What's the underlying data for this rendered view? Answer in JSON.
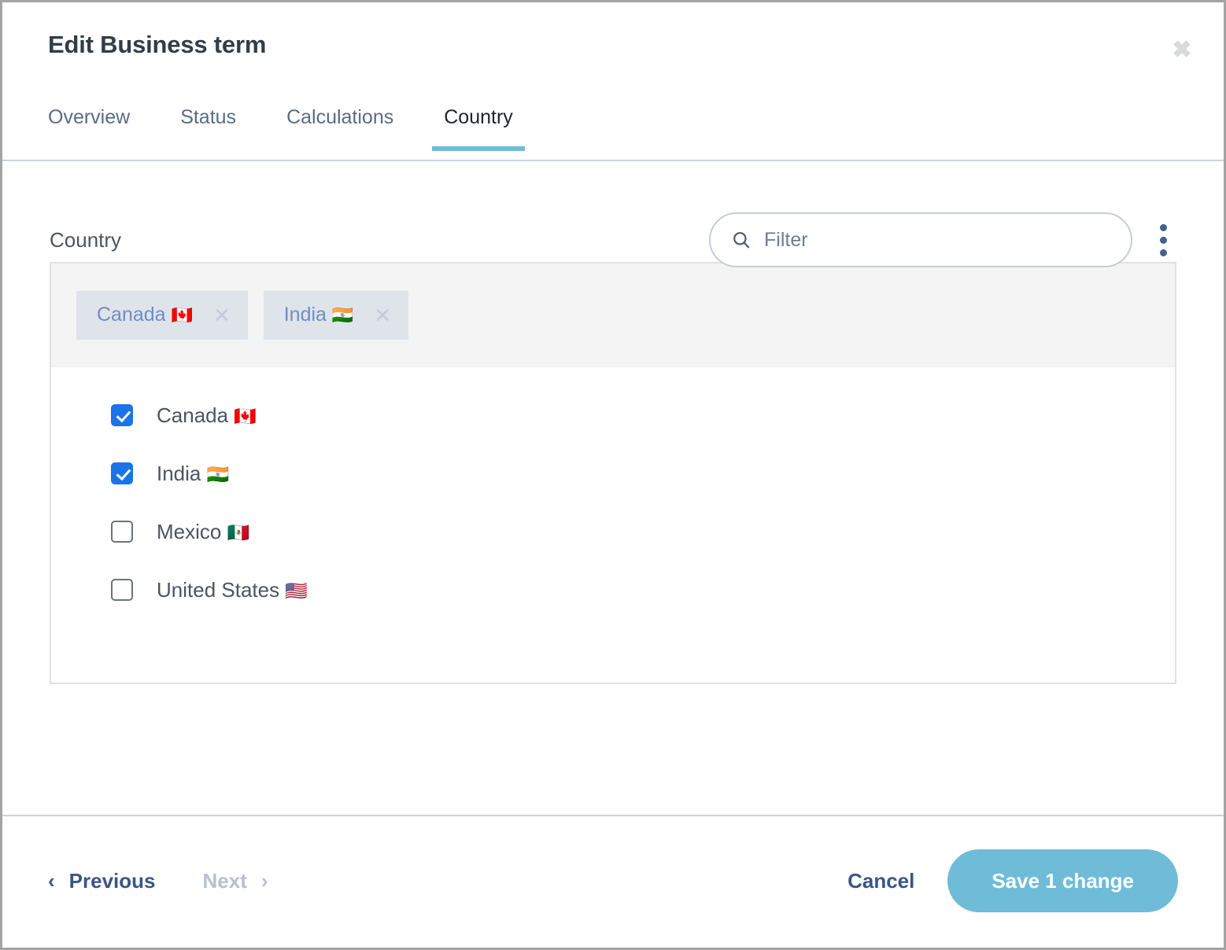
{
  "dialog": {
    "title": "Edit Business term",
    "close_icon": "close-icon",
    "close_glyph": "✖"
  },
  "tabs": [
    {
      "label": "Overview",
      "active": false
    },
    {
      "label": "Status",
      "active": false
    },
    {
      "label": "Calculations",
      "active": false
    },
    {
      "label": "Country",
      "active": true
    }
  ],
  "body": {
    "section_label": "Country",
    "filter": {
      "placeholder": "Filter",
      "value": "",
      "icon": "search-icon"
    },
    "overflow_menu": {
      "icon": "kebab-menu-icon"
    },
    "chips": [
      {
        "label": "Canada",
        "flag": "🇨🇦",
        "remove_glyph": "✕"
      },
      {
        "label": "India",
        "flag": "🇮🇳",
        "remove_glyph": "✕"
      }
    ],
    "options": [
      {
        "label": "Canada",
        "flag": "🇨🇦",
        "checked": true
      },
      {
        "label": "India",
        "flag": "🇮🇳",
        "checked": true
      },
      {
        "label": "Mexico",
        "flag": "🇲🇽",
        "checked": false
      },
      {
        "label": "United States",
        "flag": "🇺🇸",
        "checked": false
      }
    ]
  },
  "footer": {
    "previous_label": "Previous",
    "previous_chevron": "‹",
    "next_label": "Next",
    "next_chevron": "›",
    "next_disabled": true,
    "cancel_label": "Cancel",
    "save_label": "Save 1 change"
  },
  "colors": {
    "accent": "#6fbcd8",
    "tab_underline": "#6cbcda",
    "checkbox_checked": "#1a73e8",
    "link_blue": "#3a5686",
    "chip_bg": "#dfe3ea",
    "chip_text": "#6d8ec6",
    "kebab": "#41618f"
  }
}
